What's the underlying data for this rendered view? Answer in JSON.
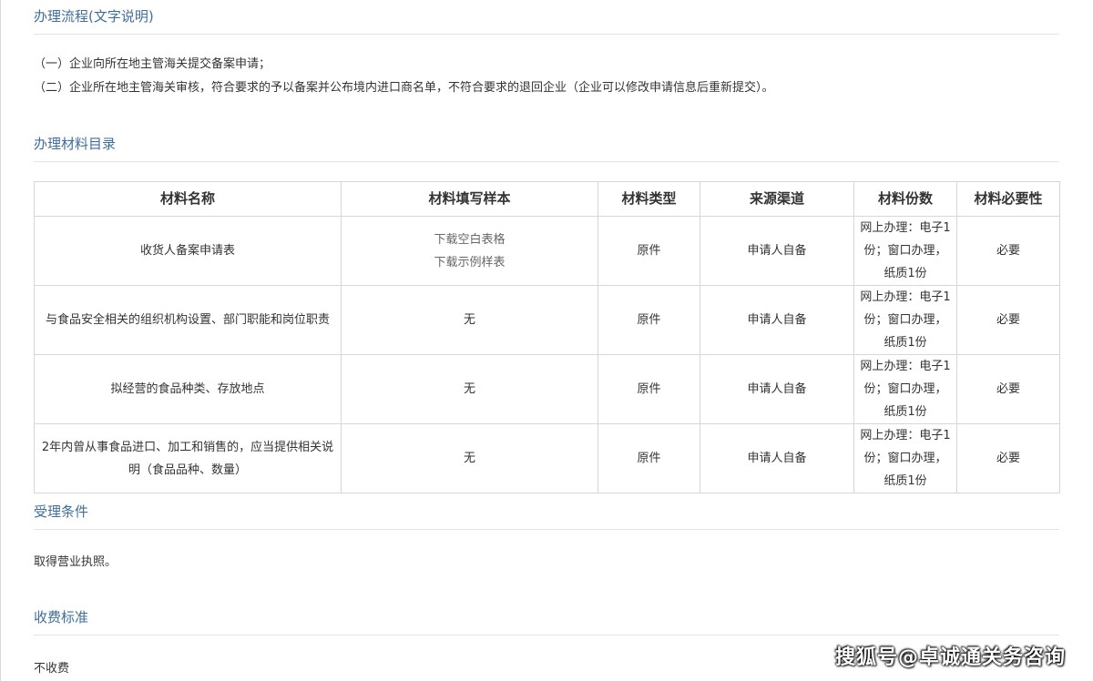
{
  "process": {
    "title": "办理流程(文字说明)",
    "steps": [
      "（一）企业向所在地主管海关提交备案申请；",
      "（二）企业所在地主管海关审核，符合要求的予以备案并公布境内进口商名单，不符合要求的退回企业（企业可以修改申请信息后重新提交）。"
    ]
  },
  "materials": {
    "title": "办理材料目录",
    "headers": [
      "材料名称",
      "材料填写样本",
      "材料类型",
      "来源渠道",
      "材料份数",
      "材料必要性"
    ],
    "rows": [
      {
        "name": "收货人备案申请表",
        "sample_blank": "下载空白表格",
        "sample_example": "下载示例样表",
        "type": "原件",
        "source": "申请人自备",
        "copies": "网上办理：电子1份；窗口办理，纸质1份",
        "necessity": "必要"
      },
      {
        "name": "与食品安全相关的组织机构设置、部门职能和岗位职责",
        "sample": "无",
        "type": "原件",
        "source": "申请人自备",
        "copies": "网上办理：电子1份；窗口办理，纸质1份",
        "necessity": "必要"
      },
      {
        "name": "拟经营的食品种类、存放地点",
        "sample": "无",
        "type": "原件",
        "source": "申请人自备",
        "copies": "网上办理：电子1份；窗口办理，纸质1份",
        "necessity": "必要"
      },
      {
        "name": "2年内曾从事食品进口、加工和销售的，应当提供相关说明（食品品种、数量）",
        "sample": "无",
        "type": "原件",
        "source": "申请人自备",
        "copies": "网上办理：电子1份；窗口办理，纸质1份",
        "necessity": "必要"
      }
    ]
  },
  "acceptance": {
    "title": "受理条件",
    "text": "取得营业执照。"
  },
  "fees": {
    "title": "收费标准",
    "text": "不收费"
  },
  "watermark": "搜狐号@卓诚通关务咨询"
}
